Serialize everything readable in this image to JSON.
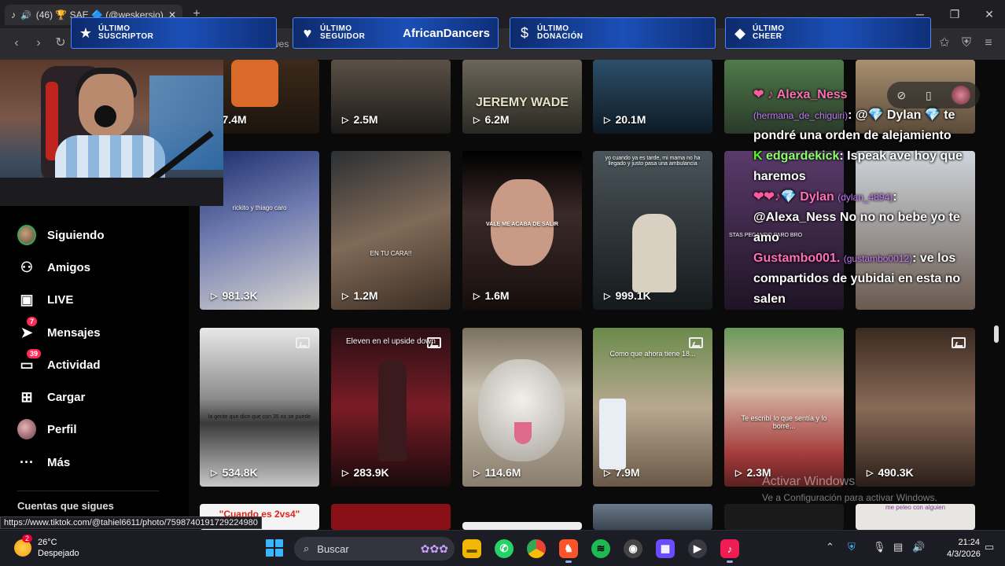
{
  "browser": {
    "tab_title": "(46) 🏆 SAE 🔷 (@weskersio) |",
    "address_partial": "wes"
  },
  "overlay": {
    "banners": [
      {
        "label1": "ÚLTIMO",
        "label2": "SUSCRIPTOR",
        "value": "",
        "icon": "star-icon"
      },
      {
        "label1": "ÚLTIMO",
        "label2": "SEGUIDOR",
        "value": "AfricanDancers",
        "icon": "heart-icon"
      },
      {
        "label1": "ÚLTIMO",
        "label2": "DONACIÓN",
        "value": "",
        "icon": "dollar-icon"
      },
      {
        "label1": "ÚLTIMO",
        "label2": "CHEER",
        "value": "",
        "icon": "diamond-icon"
      }
    ]
  },
  "sidebar": {
    "items": [
      {
        "label": "Siguiendo",
        "icon": "following-avatar-icon",
        "badge": ""
      },
      {
        "label": "Amigos",
        "icon": "friends-icon",
        "badge": ""
      },
      {
        "label": "LIVE",
        "icon": "live-icon",
        "badge": ""
      },
      {
        "label": "Mensajes",
        "icon": "messages-icon",
        "badge": "7"
      },
      {
        "label": "Actividad",
        "icon": "activity-icon",
        "badge": "39"
      },
      {
        "label": "Cargar",
        "icon": "upload-icon",
        "badge": ""
      },
      {
        "label": "Perfil",
        "icon": "profile-avatar-icon",
        "badge": ""
      },
      {
        "label": "Más",
        "icon": "more-icon",
        "badge": ""
      }
    ],
    "following_header": "Cuentas que sigues"
  },
  "grid": {
    "row1": [
      "7.4M",
      "2.5M",
      "6.2M",
      "20.1M",
      "",
      ""
    ],
    "row2": [
      "981.3K",
      "1.2M",
      "1.6M",
      "999.1K",
      "",
      ""
    ],
    "row3": [
      "534.8K",
      "283.9K",
      "114.6M",
      "7.9M",
      "2.3M",
      "490.3K"
    ],
    "captions": {
      "r1c3": "JEREMY WADE",
      "r2c1": "rickito y thiago caro",
      "r2c2": "EN TU CARA!!",
      "r2c3": "VALE ME ACABA DE SALIR",
      "r2c4": "yo cuando ya es tarde, mi mama no ha llegado y justo pasa una ambulancia",
      "r2c5": "STAS PEGANDO PARO BRO",
      "r3c1": "la gente que dice que con 35 no se puede",
      "r3c2": "Eleven en el upside down",
      "r3c4": "Como que ahora tiene 18...",
      "r3c5": "Te escribí lo que sentía y lo borré...",
      "r4c1": "\"Cuando es 2vs4\"",
      "r4c6": "me peleo con alguien"
    }
  },
  "chat": {
    "lines": [
      {
        "user": "Alexa_Ness",
        "sub": "",
        "text": ""
      },
      {
        "user": "",
        "sub": "(hermana_de_chiguiri)",
        "text": ": @💎 Dylan 💎 te pondré una orden de alejamiento"
      },
      {
        "user": "edgardekick",
        "sub": "",
        "text": ": Ispeak ave hoy que haremos"
      },
      {
        "user": "Dylan",
        "sub": "(dylan_4894)",
        "text": ": @Alexa_Ness No no no bebe yo te amo"
      },
      {
        "user": "Gustambo001.",
        "sub": "(gustambo0012)",
        "text": ": ve los compartidos de yubidai en esta no salen"
      }
    ]
  },
  "watermark": {
    "title": "Activar Windows",
    "subtitle": "Ve a Configuración para activar Windows."
  },
  "status_url": "https://www.tiktok.com/@tahiel6611/photo/7598740191729224980",
  "taskbar": {
    "weather_temp": "26°C",
    "weather_desc": "Despejado",
    "weather_badge": "2",
    "search_placeholder": "Buscar",
    "time": "21:24",
    "date": "4/3/2026"
  }
}
